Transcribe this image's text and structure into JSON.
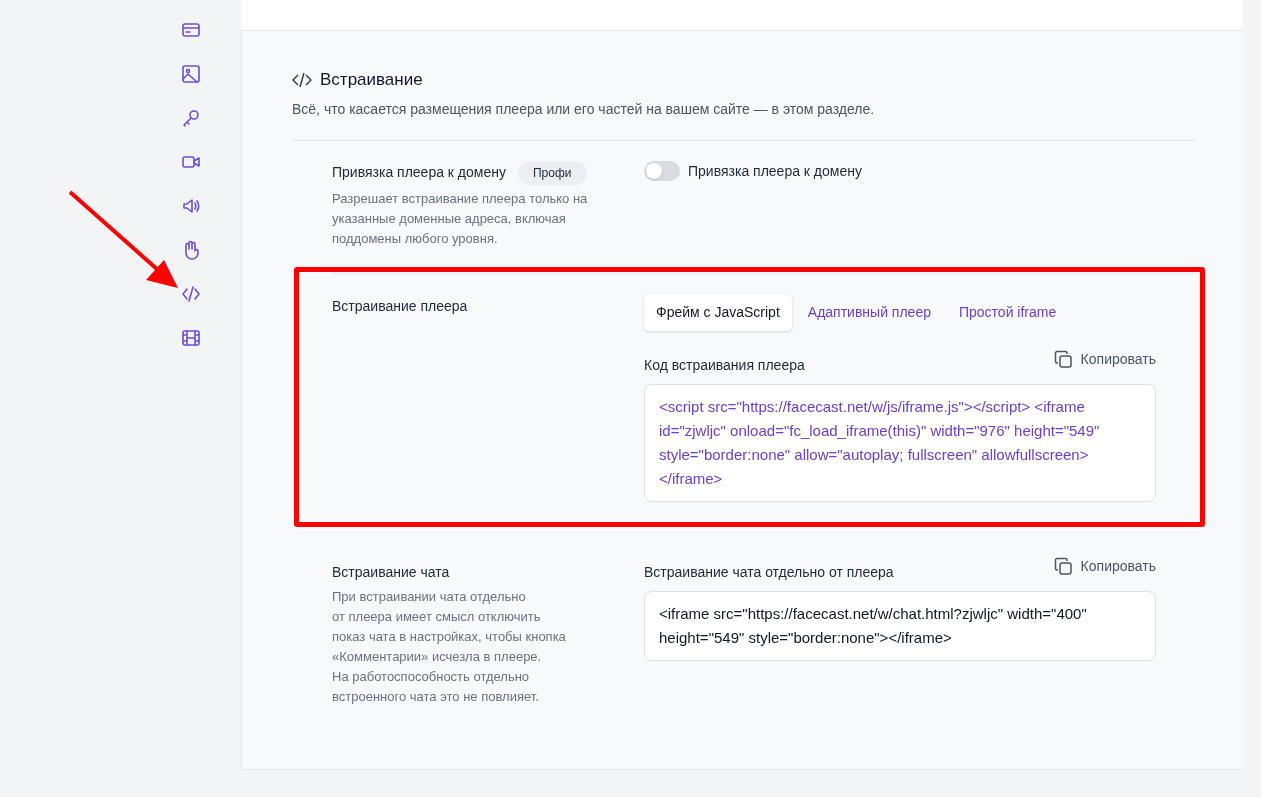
{
  "section": {
    "title": "Встраивание",
    "subtitle": "Всё, что касается размещения плеера или его частей на вашем сайте — в этом разделе."
  },
  "settings": [
    {
      "kind": "toggle",
      "label": "Привязка плеера к домену",
      "badge": "Профи",
      "description": "Разрешает встраивание плеера только на указанные доменные адреса, включая поддомены любого уровня.",
      "toggle": {
        "label": "Привязка плеера к домену",
        "on": false
      }
    },
    {
      "kind": "code",
      "label": "Встраивание плеера",
      "tabs": [
        {
          "label": "Фрейм с JavaScript",
          "selected": true
        },
        {
          "label": "Адаптивный плеер",
          "selected": false
        },
        {
          "label": "Простой iframe",
          "selected": false
        }
      ],
      "field_label": "Код встраивания плеера",
      "copy": "Копировать",
      "code": "<script src=\"https://facecast.net/w/js/iframe.js\"></script> <iframe id=\"zjwljc\" onload=\"fc_load_iframe(this)\" width=\"976\" height=\"549\" style=\"border:none\" allow=\"autoplay; fullscreen\" allowfullscreen></iframe>",
      "highlighted": true
    },
    {
      "kind": "code",
      "label": "Встраивание чата",
      "description": "При встраивании чата отдельно\nот плеера имеет смысл отключить\nпоказ чата в настройках, чтобы кнопка\n«Комментарии» исчезла в плеере.\nНа работоспособность отдельно\nвстроенного чата это не повлияет.",
      "field_label": "Встраивание чата отдельно от плеера",
      "copy": "Копировать",
      "code": "<iframe src=\"https://facecast.net/w/chat.html?zjwljc\" width=\"400\" height=\"549\" style=\"border:none\"></iframe>",
      "highlighted": false
    }
  ]
}
